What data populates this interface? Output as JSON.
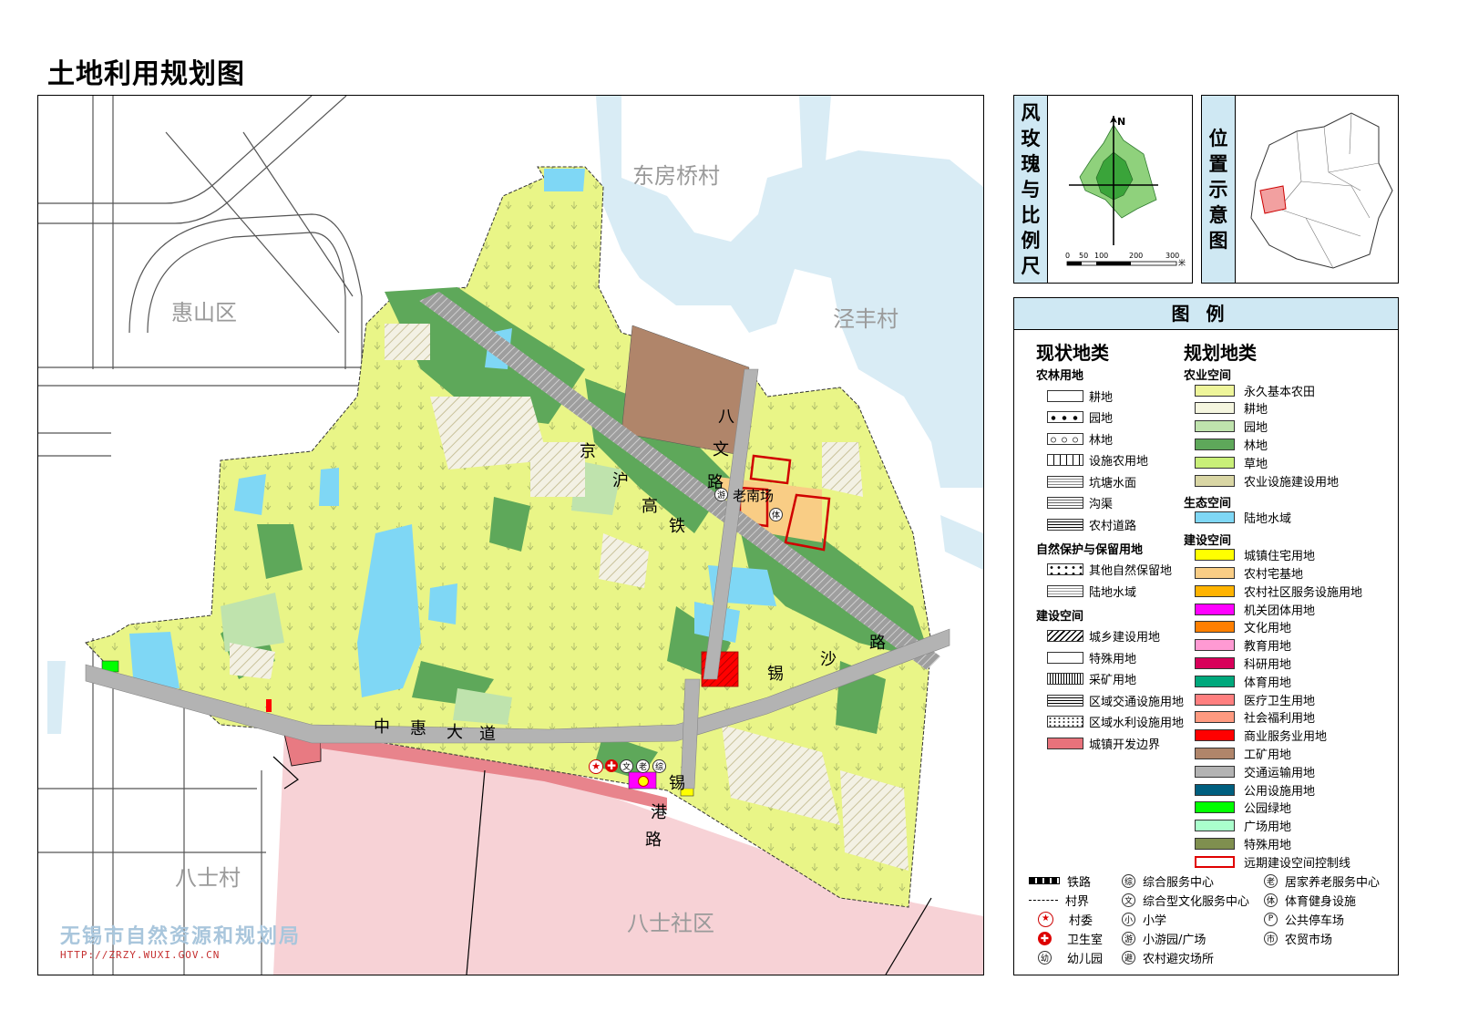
{
  "title": "土地利用规划图",
  "map": {
    "places": {
      "dongfangqiao": "东房桥村",
      "huishan": "惠山区",
      "jingfeng": "泾丰村",
      "bashi_village": "八士村",
      "bashi_community": "八士社区"
    },
    "roads": {
      "jinghu": [
        "京",
        "沪",
        "高",
        "铁"
      ],
      "xisha": [
        "锡",
        "沙",
        "路"
      ],
      "zhonghui": [
        "中",
        "惠",
        "大",
        "道"
      ],
      "bawen": [
        "八",
        "文",
        "路"
      ],
      "xigang": [
        "锡",
        "港",
        "路"
      ]
    },
    "poi": {
      "laonanchang": "老南场",
      "you": "游",
      "ti": "体",
      "wen": "文",
      "lao": "老",
      "zong": "综"
    },
    "agency": "无锡市自然资源和规划局",
    "url": "HTTP://ZRZY.WUXI.GOV.CN"
  },
  "wind_panel": {
    "label": [
      "风",
      "玫",
      "瑰",
      "与",
      "比",
      "例",
      "尺"
    ],
    "north": "N",
    "scale_ticks": [
      "0",
      "50",
      "100",
      "200",
      "300"
    ],
    "scale_unit": "米"
  },
  "location_panel": {
    "label": [
      "位",
      "置",
      "示",
      "意",
      "图"
    ]
  },
  "legend": {
    "header": "图例",
    "current_title": "现状地类",
    "planned_title": "规划地类",
    "current_groups": [
      {
        "title": "农林用地",
        "items": [
          {
            "label": "耕地",
            "pattern": "farmland"
          },
          {
            "label": "园地",
            "pattern": "garden"
          },
          {
            "label": "林地",
            "pattern": "forest"
          },
          {
            "label": "设施农用地",
            "pattern": "facility"
          },
          {
            "label": "坑塘水面",
            "pattern": "pond"
          },
          {
            "label": "沟渠",
            "pattern": "ditch"
          },
          {
            "label": "农村道路",
            "pattern": "road"
          }
        ]
      },
      {
        "title": "自然保护与保留用地",
        "items": [
          {
            "label": "其他自然保留地",
            "pattern": "reserve"
          },
          {
            "label": "陆地水域",
            "pattern": "water"
          }
        ]
      },
      {
        "title": "建设空间",
        "items": [
          {
            "label": "城乡建设用地",
            "pattern": "urban"
          },
          {
            "label": "特殊用地",
            "pattern": "special"
          },
          {
            "label": "采矿用地",
            "pattern": "mining"
          },
          {
            "label": "区域交通设施用地",
            "pattern": "transport"
          },
          {
            "label": "区域水利设施用地",
            "pattern": "waterworks"
          },
          {
            "label": "城镇开发边界",
            "pattern": "boundary"
          }
        ]
      }
    ],
    "planned_groups": [
      {
        "title": "农业空间",
        "items": [
          {
            "label": "永久基本农田",
            "color": "#eef59a"
          },
          {
            "label": "耕地",
            "color": "#f5f6df"
          },
          {
            "label": "园地",
            "color": "#bfe3ad"
          },
          {
            "label": "林地",
            "color": "#5ea85a"
          },
          {
            "label": "草地",
            "color": "#c9ef78"
          },
          {
            "label": "农业设施建设用地",
            "color": "#d9d6a4"
          }
        ]
      },
      {
        "title": "生态空间",
        "items": [
          {
            "label": "陆地水域",
            "color": "#7fd7f5"
          }
        ]
      },
      {
        "title": "建设空间",
        "items": [
          {
            "label": "城镇住宅用地",
            "color": "#ffff00"
          },
          {
            "label": "农村宅基地",
            "color": "#f9cd85"
          },
          {
            "label": "农村社区服务设施用地",
            "color": "#ffb300"
          },
          {
            "label": "机关团体用地",
            "color": "#ff00ff"
          },
          {
            "label": "文化用地",
            "color": "#ff7f00"
          },
          {
            "label": "教育用地",
            "color": "#ff9ad3"
          },
          {
            "label": "科研用地",
            "color": "#d8005a"
          },
          {
            "label": "体育用地",
            "color": "#00a87c"
          },
          {
            "label": "医疗卫生用地",
            "color": "#ff7f7f"
          },
          {
            "label": "社会福利用地",
            "color": "#ff9a80"
          },
          {
            "label": "商业服务业用地",
            "color": "#ff0000"
          },
          {
            "label": "工矿用地",
            "color": "#b0856a"
          },
          {
            "label": "交通运输用地",
            "color": "#b3b3b3"
          },
          {
            "label": "公用设施用地",
            "color": "#005f7f"
          },
          {
            "label": "公园绿地",
            "color": "#00ff00"
          },
          {
            "label": "广场用地",
            "color": "#aaffcc"
          },
          {
            "label": "特殊用地",
            "color": "#7f8f4f"
          },
          {
            "label": "远期建设空间控制线",
            "color": "#ffffff"
          }
        ]
      }
    ],
    "symbols_col1": [
      {
        "label": "铁路",
        "icon": "railway-icon"
      },
      {
        "label": "村界",
        "icon": "village-boundary-icon"
      },
      {
        "label": "村委",
        "icon": "village-committee-icon"
      },
      {
        "label": "卫生室",
        "icon": "clinic-icon"
      },
      {
        "label": "幼儿园",
        "glyph": "幼",
        "icon": "kindergarten-icon"
      }
    ],
    "symbols_col2": [
      {
        "label": "综合服务中心",
        "glyph": "综"
      },
      {
        "label": "综合型文化服务中心",
        "glyph": "文"
      },
      {
        "label": "小学",
        "glyph": "小"
      },
      {
        "label": "小游园/广场",
        "glyph": "游"
      },
      {
        "label": "农村避灾场所",
        "glyph": "避"
      }
    ],
    "symbols_col3": [
      {
        "label": "居家养老服务中心",
        "glyph": "老"
      },
      {
        "label": "体育健身设施",
        "glyph": "体"
      },
      {
        "label": "公共停车场",
        "glyph": "P"
      },
      {
        "label": "农贸市场",
        "glyph": "市"
      }
    ]
  }
}
